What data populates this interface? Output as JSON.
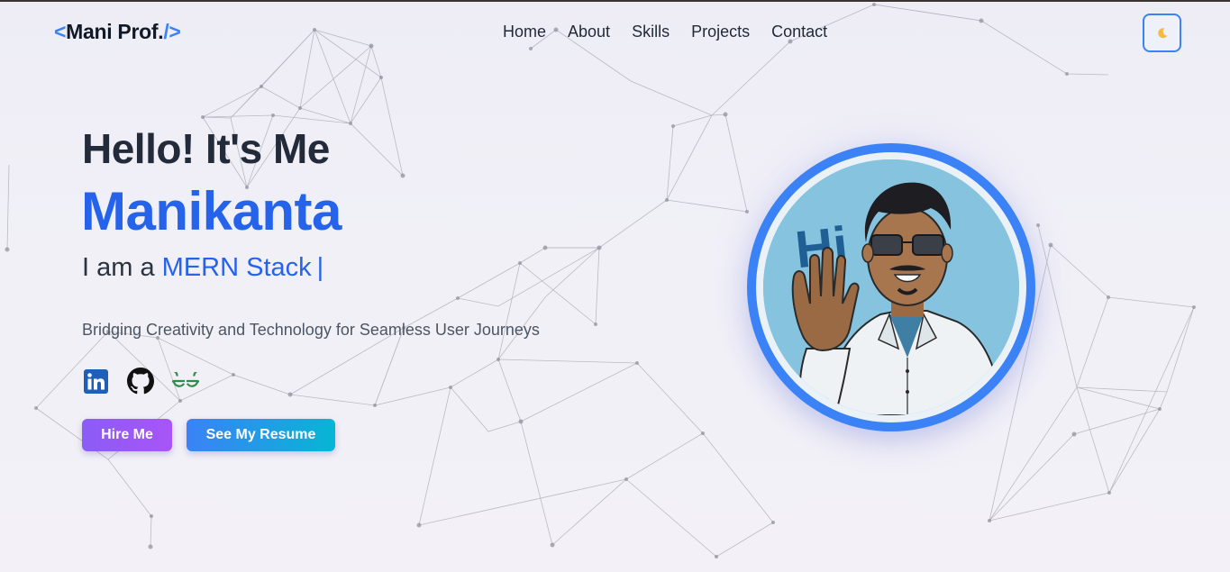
{
  "brand": {
    "open_bracket": "<",
    "name": "Mani Prof.",
    "close_bracket": "/>"
  },
  "nav": {
    "links": [
      "Home",
      "About",
      "Skills",
      "Projects",
      "Contact"
    ]
  },
  "theme_toggle": {
    "icon": "moon-icon",
    "glyph": "🌙"
  },
  "hero": {
    "greeting": "Hello! It's Me",
    "name": "Manikanta",
    "role_prefix": "I am a",
    "role_highlight": "MERN Stack",
    "caret": "|",
    "tagline": "Bridging Creativity and Technology for Seamless User Journeys"
  },
  "socials": [
    {
      "icon": "linkedin-icon",
      "color": "#1f5fb8"
    },
    {
      "icon": "github-icon",
      "color": "#111111"
    },
    {
      "icon": "geeksforgeeks-icon",
      "color": "#2f8d46"
    }
  ],
  "buttons": {
    "hire": "Hire Me",
    "resume": "See My Resume"
  },
  "avatar": {
    "greeting_text": "Hi",
    "ring_color": "#3b82f6"
  },
  "colors": {
    "accent": "#2563eb",
    "accent_light": "#3b82f6",
    "hire_gradient": [
      "#8b5cf6",
      "#a855f7"
    ],
    "resume_gradient": [
      "#3b82f6",
      "#06b6d4"
    ]
  }
}
